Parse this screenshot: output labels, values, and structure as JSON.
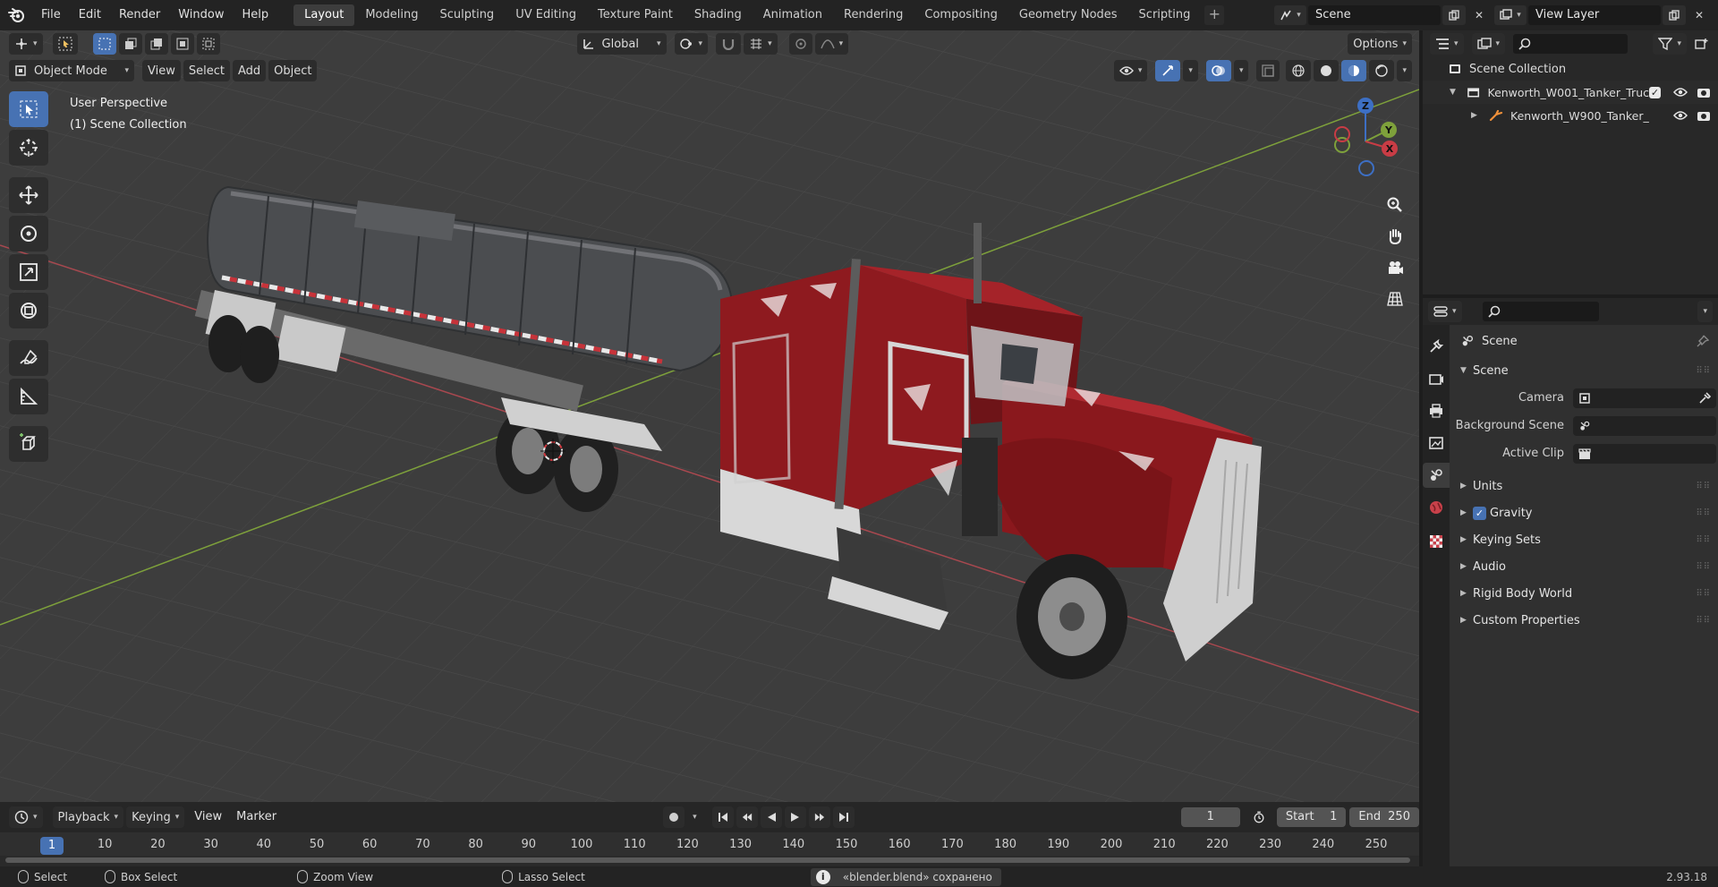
{
  "topbar": {
    "menus": [
      "File",
      "Edit",
      "Render",
      "Window",
      "Help"
    ],
    "workspaces": [
      "Layout",
      "Modeling",
      "Sculpting",
      "UV Editing",
      "Texture Paint",
      "Shading",
      "Animation",
      "Rendering",
      "Compositing",
      "Geometry Nodes",
      "Scripting"
    ],
    "active_workspace": "Layout",
    "add_tab": "+",
    "scene_name": "Scene",
    "view_layer": "View Layer"
  },
  "viewport": {
    "transform_orientation": "Global",
    "options_label": "Options",
    "mode": "Object Mode",
    "menus": [
      "View",
      "Select",
      "Add",
      "Object"
    ],
    "perspective_label": "User Perspective",
    "collection_label": "(1) Scene Collection",
    "gizmo_axes": {
      "x": "X",
      "y": "Y",
      "z": "Z"
    },
    "colors": {
      "background": "#3d3d3d",
      "grid": "#4a4a4a",
      "x_axis": "#a8484f",
      "y_axis": "#7ea13b",
      "active": "#4772b3"
    }
  },
  "timeline": {
    "menus": [
      "Playback",
      "Keying",
      "View",
      "Marker"
    ],
    "current_frame": "1",
    "start_label": "Start",
    "start_value": "1",
    "end_label": "End",
    "end_value": "250",
    "ruler_marks": [
      "1",
      "10",
      "20",
      "30",
      "40",
      "50",
      "60",
      "70",
      "80",
      "90",
      "100",
      "110",
      "120",
      "130",
      "140",
      "150",
      "160",
      "170",
      "180",
      "190",
      "200",
      "210",
      "220",
      "230",
      "240",
      "250"
    ]
  },
  "statusbar": {
    "select": "Select",
    "box_select": "Box Select",
    "zoom_view": "Zoom View",
    "lasso_select": "Lasso Select",
    "notification": "«blender.blend» сохранено",
    "version": "2.93.18"
  },
  "outliner": {
    "root": "Scene Collection",
    "items": [
      {
        "label": "Kenworth_W001_Tanker_Truc",
        "type": "collection"
      },
      {
        "label": "Kenworth_W900_Tanker_",
        "type": "object"
      }
    ]
  },
  "properties": {
    "context": "Scene",
    "panel_title": "Scene",
    "fields": {
      "camera_label": "Camera",
      "background_scene_label": "Background Scene",
      "active_clip_label": "Active Clip"
    },
    "subpanels": [
      "Units",
      "Gravity",
      "Keying Sets",
      "Audio",
      "Rigid Body World",
      "Custom Properties"
    ]
  }
}
